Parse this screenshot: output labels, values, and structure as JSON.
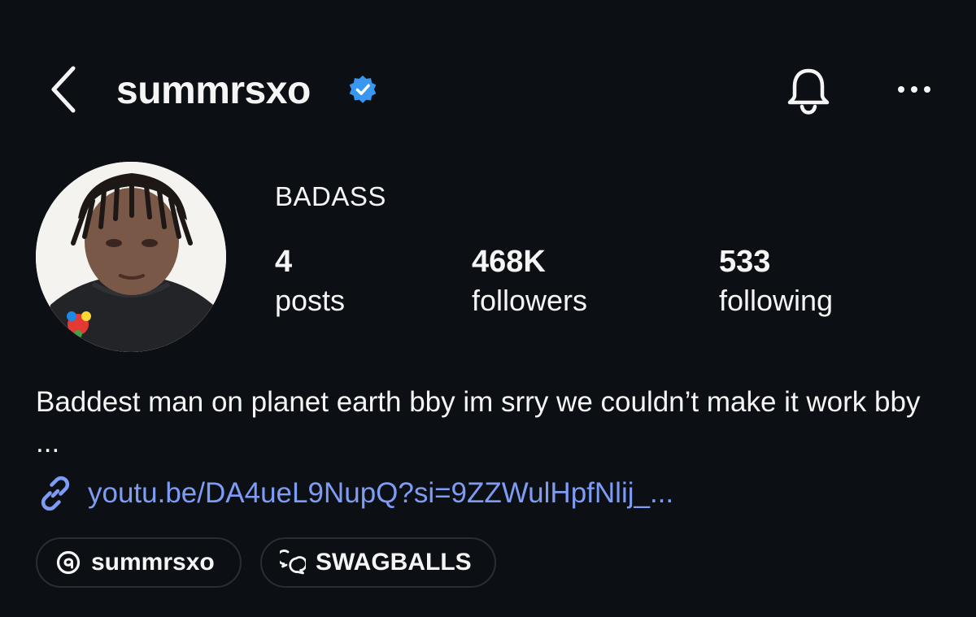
{
  "header": {
    "username": "summrsxo",
    "verified": true,
    "icons": [
      "back-chevron-icon",
      "verified-badge-icon",
      "bell-icon",
      "more-options-icon"
    ]
  },
  "profile": {
    "display_name": "BADASS",
    "stats": [
      {
        "count": "4",
        "label": "posts"
      },
      {
        "count": "468K",
        "label": "followers"
      },
      {
        "count": "533",
        "label": "following"
      }
    ],
    "bio": "Baddest man on planet earth bby im srry we couldn’t make it work bby ...",
    "link": {
      "text": "youtu.be/DA4ueL9NupQ?si=9ZZWulHpfNlij_...",
      "icon": "link-icon"
    },
    "chips": [
      {
        "icon": "threads-icon",
        "label": "summrsxo"
      },
      {
        "icon": "chat-bubbles-icon",
        "label": "SWAGBALLS"
      }
    ]
  },
  "colors": {
    "background": "#0c1014",
    "text": "#f5f5f5",
    "verified": "#3897f0",
    "link": "#7f9cf5",
    "chip_border": "#2a2e33"
  }
}
